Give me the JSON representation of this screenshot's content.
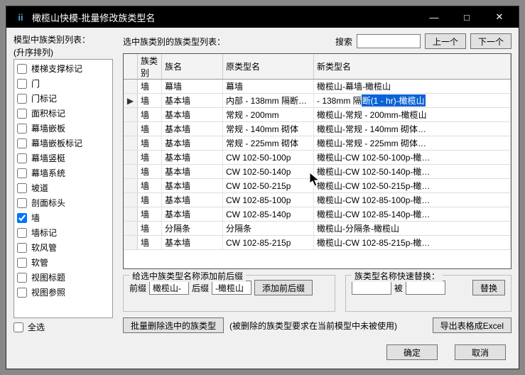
{
  "title": "橄榄山快模-批量修改族类型名",
  "winbtns": {
    "min": "—",
    "max": "□",
    "close": "✕"
  },
  "left_header": "模型中族类别列表：",
  "left_sort": "(升序排列)",
  "categories": [
    {
      "label": "楼梯支撑标记",
      "checked": false
    },
    {
      "label": "门",
      "checked": false
    },
    {
      "label": "门标记",
      "checked": false
    },
    {
      "label": "面积标记",
      "checked": false
    },
    {
      "label": "幕墙嵌板",
      "checked": false
    },
    {
      "label": "幕墙嵌板标记",
      "checked": false
    },
    {
      "label": "幕墙竖梃",
      "checked": false
    },
    {
      "label": "幕墙系统",
      "checked": false
    },
    {
      "label": "坡道",
      "checked": false
    },
    {
      "label": "剖面标头",
      "checked": false
    },
    {
      "label": "墙",
      "checked": true
    },
    {
      "label": "墙标记",
      "checked": false
    },
    {
      "label": "软风管",
      "checked": false
    },
    {
      "label": "软管",
      "checked": false
    },
    {
      "label": "视图标题",
      "checked": false
    },
    {
      "label": "视图参照",
      "checked": false
    }
  ],
  "select_all_label": "全选",
  "right_label": "选中族类别的族类型列表：",
  "search_label": "搜索",
  "prev": "上一个",
  "next": "下一个",
  "grid_headers": {
    "cat": "族类别",
    "name": "族名",
    "orig": "原类型名",
    "new": "新类型名"
  },
  "rows": [
    {
      "cat": "墙",
      "name": "幕墙",
      "orig": "幕墙",
      "new": "橄榄山-幕墙-橄榄山",
      "sel": false
    },
    {
      "cat": "墙",
      "name": "基本墙",
      "orig": "内部 - 138mm 隔断…",
      "new": "- 138mm 隔",
      "new_hl": "断(1 - hr)-橄榄山",
      "sel": true
    },
    {
      "cat": "墙",
      "name": "基本墙",
      "orig": "常规 - 200mm",
      "new": "橄榄山-常规 - 200mm-橄榄山",
      "sel": false
    },
    {
      "cat": "墙",
      "name": "基本墙",
      "orig": "常规 - 140mm 砌体",
      "new": "橄榄山-常规 - 140mm 砌体…",
      "sel": false
    },
    {
      "cat": "墙",
      "name": "基本墙",
      "orig": "常规 - 225mm 砌体",
      "new": "橄榄山-常规 - 225mm 砌体…",
      "sel": false
    },
    {
      "cat": "墙",
      "name": "基本墙",
      "orig": "CW 102-50-100p",
      "new": "橄榄山-CW 102-50-100p-橄…",
      "sel": false
    },
    {
      "cat": "墙",
      "name": "基本墙",
      "orig": "CW 102-50-140p",
      "new": "橄榄山-CW 102-50-140p-橄…",
      "sel": false
    },
    {
      "cat": "墙",
      "name": "基本墙",
      "orig": "CW 102-50-215p",
      "new": "橄榄山-CW 102-50-215p-橄…",
      "sel": false
    },
    {
      "cat": "墙",
      "name": "基本墙",
      "orig": "CW 102-85-100p",
      "new": "橄榄山-CW 102-85-100p-橄…",
      "sel": false
    },
    {
      "cat": "墙",
      "name": "基本墙",
      "orig": "CW 102-85-140p",
      "new": "橄榄山-CW 102-85-140p-橄…",
      "sel": false
    },
    {
      "cat": "墙",
      "name": "分隔条",
      "orig": "分隔条",
      "new": "橄榄山-分隔条-橄榄山",
      "sel": false
    },
    {
      "cat": "墙",
      "name": "基本墙",
      "orig": "CW 102-85-215p",
      "new": "橄榄山-CW 102-85-215p-橄…",
      "sel": false
    }
  ],
  "affix": {
    "legend": "给选中族类型名称添加前后缀",
    "prefix_label": "前缀",
    "prefix_val": "橄榄山-",
    "suffix_label": "后缀",
    "suffix_val": "-橄榄山",
    "btn": "添加前后缀"
  },
  "replace": {
    "legend": "族类型名称快速替换：",
    "to_label": "被",
    "btn": "替换"
  },
  "bulk": {
    "delete": "批量删除选中的族类型",
    "note": "(被删除的族类型要求在当前模型中未被使用)",
    "export": "导出表格成Excel"
  },
  "footer": {
    "ok": "确定",
    "cancel": "取消"
  }
}
